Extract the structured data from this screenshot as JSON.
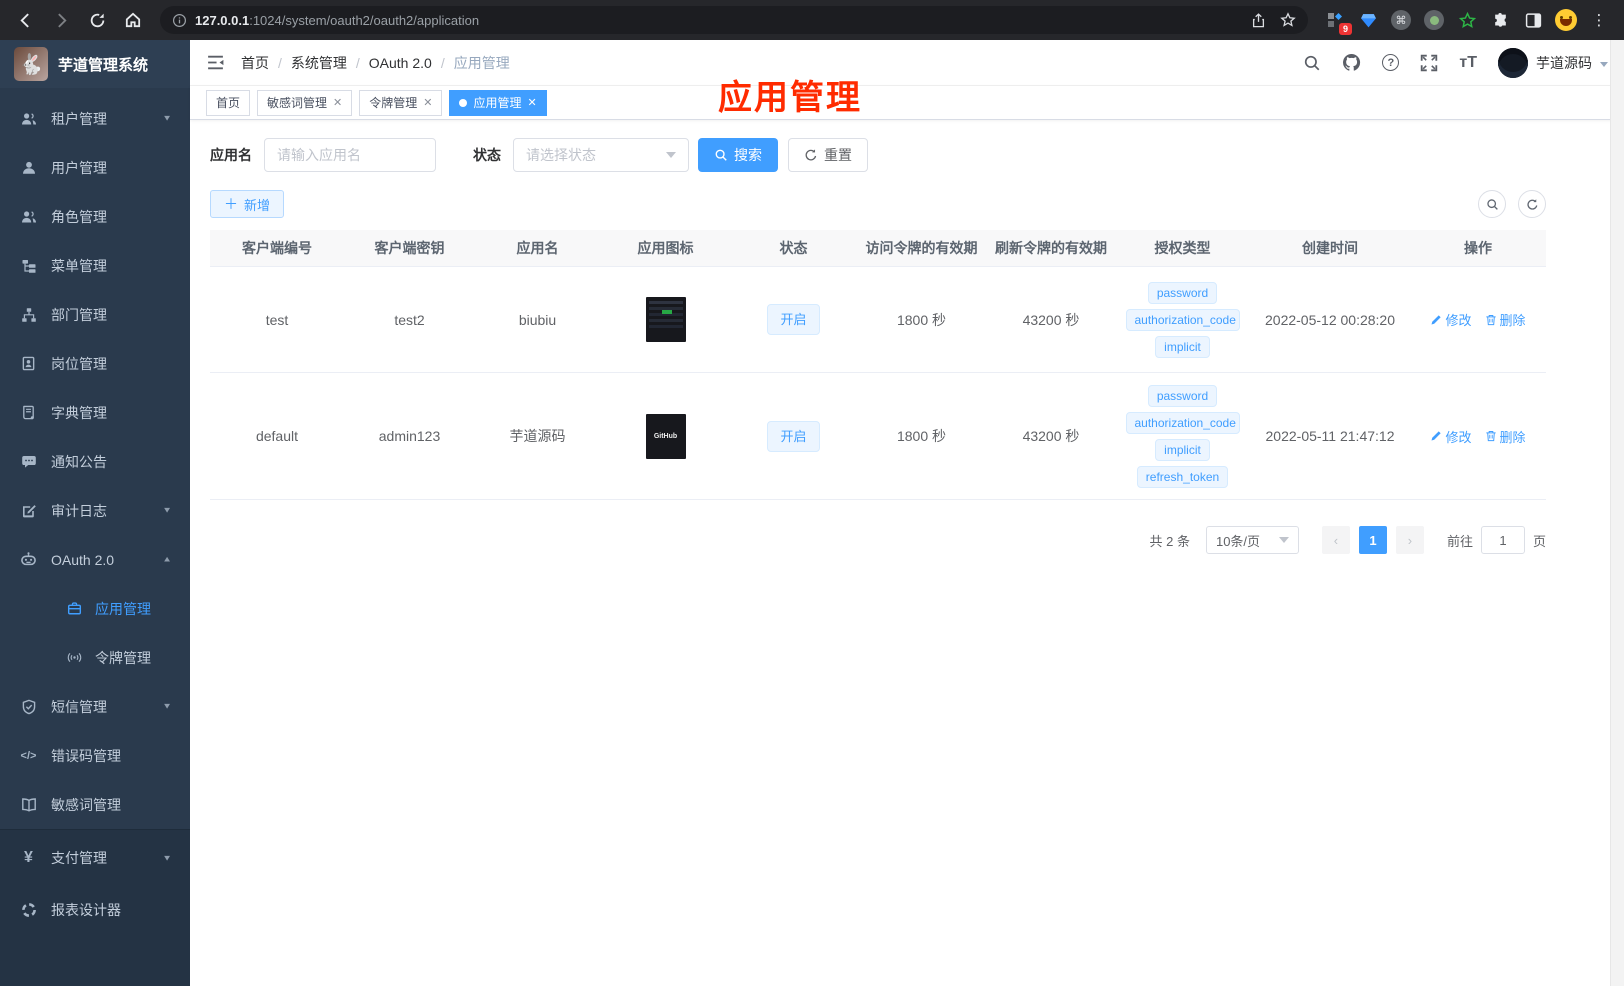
{
  "browser": {
    "url_host": "127.0.0.1",
    "url_rest": ":1024/system/oauth2/oauth2/application",
    "ext_badge": "9"
  },
  "sidebar": {
    "title": "芋道管理系统",
    "items": [
      {
        "label": "租户管理"
      },
      {
        "label": "用户管理"
      },
      {
        "label": "角色管理"
      },
      {
        "label": "菜单管理"
      },
      {
        "label": "部门管理"
      },
      {
        "label": "岗位管理"
      },
      {
        "label": "字典管理"
      },
      {
        "label": "通知公告"
      },
      {
        "label": "审计日志"
      },
      {
        "label": "OAuth 2.0"
      },
      {
        "label": "应用管理"
      },
      {
        "label": "令牌管理"
      },
      {
        "label": "短信管理"
      },
      {
        "label": "错误码管理"
      },
      {
        "label": "敏感词管理"
      },
      {
        "label": "支付管理"
      },
      {
        "label": "报表设计器"
      }
    ]
  },
  "header": {
    "breadcrumb": [
      "首页",
      "系统管理",
      "OAuth 2.0",
      "应用管理"
    ],
    "username": "芋道源码"
  },
  "tabs": [
    {
      "label": "首页"
    },
    {
      "label": "敏感词管理"
    },
    {
      "label": "令牌管理"
    },
    {
      "label": "应用管理"
    }
  ],
  "annotation": {
    "text": "应用管理",
    "color": "#ff2b00"
  },
  "filters": {
    "name_label": "应用名",
    "name_placeholder": "请输入应用名",
    "status_label": "状态",
    "status_placeholder": "请选择状态",
    "search_label": "搜索",
    "reset_label": "重置"
  },
  "toolbar": {
    "add_label": "新增"
  },
  "table": {
    "columns": [
      "客户端编号",
      "客户端密钥",
      "应用名",
      "应用图标",
      "状态",
      "访问令牌的有效期",
      "刷新令牌的有效期",
      "授权类型",
      "创建时间",
      "操作"
    ],
    "edit_label": "修改",
    "delete_label": "删除",
    "rows": [
      {
        "client_id": "test",
        "secret": "test2",
        "name": "biubiu",
        "status": "开启",
        "access_ttl": "1800 秒",
        "refresh_ttl": "43200 秒",
        "grants": [
          "password",
          "authorization_code",
          "implicit"
        ],
        "created": "2022-05-12 00:28:20"
      },
      {
        "client_id": "default",
        "secret": "admin123",
        "name": "芋道源码",
        "status": "开启",
        "access_ttl": "1800 秒",
        "refresh_ttl": "43200 秒",
        "grants": [
          "password",
          "authorization_code",
          "implicit",
          "refresh_token"
        ],
        "created": "2022-05-11 21:47:12",
        "icon_text": "GitHub"
      }
    ]
  },
  "pagination": {
    "total": "共 2 条",
    "page_size": "10条/页",
    "current": "1",
    "goto_label": "前往",
    "goto_value": "1",
    "page_label": "页"
  },
  "colors": {
    "accent": "#409eff",
    "sidebar_bg": "#2a3a4d",
    "annotation": "#ff2b00"
  }
}
